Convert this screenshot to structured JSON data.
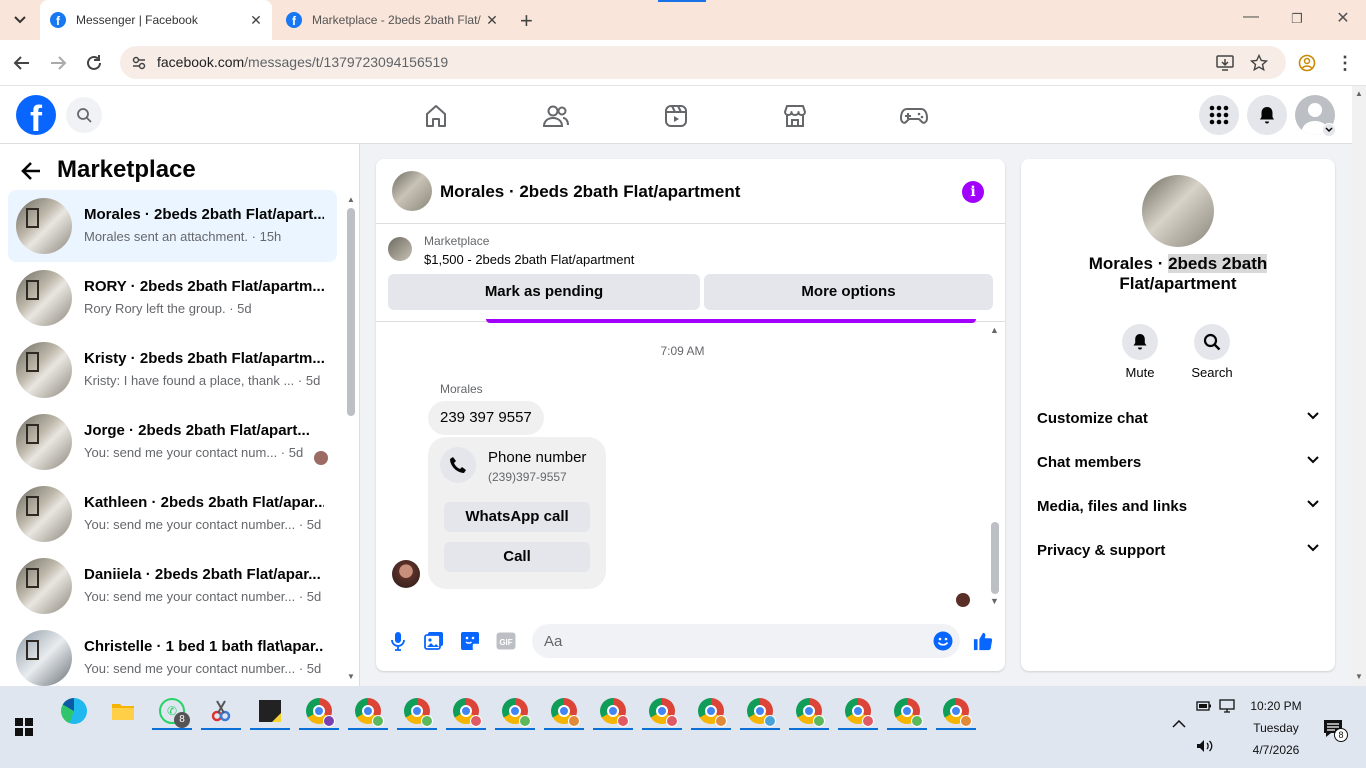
{
  "browser": {
    "tabs": [
      {
        "title": "Messenger | Facebook",
        "active": true
      },
      {
        "title": "Marketplace - 2beds 2bath Flat/",
        "active": false
      }
    ],
    "new_tab_glyph": "+",
    "url_host": "facebook.com",
    "url_path": "/messages/t/1379723094156519",
    "window_controls": {
      "minimize": "—",
      "restore": "❐",
      "close": "✕"
    }
  },
  "fb_header": {
    "logo_letter": "f",
    "nav_icons": [
      "home-icon",
      "friends-icon",
      "video-icon",
      "marketplace-icon",
      "gaming-icon"
    ],
    "right_icons": [
      "menu-grid-icon",
      "notifications-bell-icon",
      "account-avatar"
    ]
  },
  "left_panel": {
    "back_glyph": "←",
    "title": "Marketplace",
    "chats": [
      {
        "name": "Morales · 2beds 2bath Flat/apart...",
        "preview": "Morales sent an attachment. · 15h",
        "active": true
      },
      {
        "name": "RORY · 2beds 2bath Flat/apartm...",
        "preview": "Rory Rory left the group. · 5d",
        "active": false
      },
      {
        "name": "Kristy · 2beds 2bath Flat/apartm...",
        "preview": "Kristy: I have found a place, thank ... · 5d",
        "active": false
      },
      {
        "name": "Jorge · 2beds 2bath Flat/apart...",
        "preview": "You: send me your contact num... · 5d",
        "active": false
      },
      {
        "name": "Kathleen · 2beds 2bath Flat/apar...",
        "preview": "You: send me your contact number... · 5d",
        "active": false
      },
      {
        "name": "Daniiela · 2beds 2bath Flat/apar...",
        "preview": "You: send me your contact number... · 5d",
        "active": false
      },
      {
        "name": "Christelle · 1 bed 1 bath flat\\apar...",
        "preview": "You: send me your contact number... · 5d",
        "active": false
      }
    ]
  },
  "conversation": {
    "title": "Morales · 2beds 2bath Flat/apartment",
    "info_glyph": "i",
    "marketplace": {
      "label": "Marketplace",
      "listing": "$1,500 - 2beds 2bath Flat/apartment",
      "mark_pending": "Mark as pending",
      "more_options": "More options"
    },
    "timestamp": "7:09 AM",
    "sender": "Morales",
    "message": "239 397 9557",
    "phone_card": {
      "title": "Phone number",
      "number": "(239)397-9557",
      "whatsapp_call": "WhatsApp call",
      "call": "Call"
    },
    "composer": {
      "placeholder": "Aa",
      "icons": [
        "microphone-icon",
        "photo-icon",
        "sticker-icon",
        "gif-icon",
        "emoji-icon",
        "thumbs-up-icon"
      ]
    }
  },
  "right_panel": {
    "name_part1": "Morales · ",
    "name_part2": "2beds 2bath",
    "name_part3": "Flat/apartment",
    "actions": [
      {
        "label": "Mute",
        "icon": "bell-icon"
      },
      {
        "label": "Search",
        "icon": "search-icon"
      }
    ],
    "sections": [
      "Customize chat",
      "Chat members",
      "Media, files and links",
      "Privacy & support"
    ]
  },
  "taskbar": {
    "whatsapp_badge": "8",
    "notification_badge": "8",
    "clock_time": "10:20 PM",
    "clock_day": "Tuesday",
    "clock_date": "4/7/2026"
  },
  "colors": {
    "fb_blue": "#0866ff",
    "accent_purple": "#a100ff",
    "active_chat_bg": "#ebf5ff"
  }
}
